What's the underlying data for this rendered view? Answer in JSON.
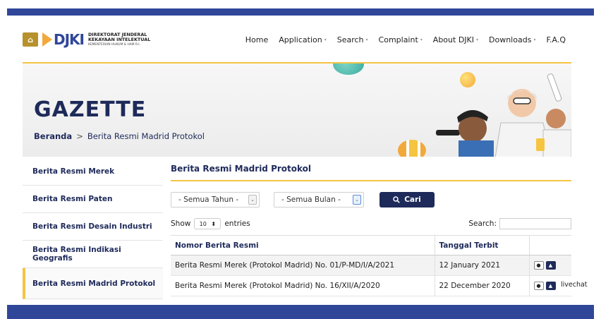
{
  "brand": {
    "line1": "DIREKTORAT JENDERAL",
    "line2": "KEKAYAAN INTELEKTUAL",
    "line3": "KEMENTERIAN HUKUM & HAM R.I.",
    "mark": "DJKI"
  },
  "nav": [
    {
      "label": "Home",
      "has_caret": false
    },
    {
      "label": "Application",
      "has_caret": true
    },
    {
      "label": "Search",
      "has_caret": true
    },
    {
      "label": "Complaint",
      "has_caret": true
    },
    {
      "label": "About DJKI",
      "has_caret": true
    },
    {
      "label": "Downloads",
      "has_caret": true
    },
    {
      "label": "F.A.Q",
      "has_caret": false
    }
  ],
  "hero": {
    "title": "GAZETTE",
    "breadcrumb_home": "Beranda",
    "breadcrumb_sep": ">",
    "breadcrumb_current": "Berita Resmi Madrid Protokol"
  },
  "sidebar": [
    {
      "label": "Berita Resmi Merek",
      "active": false
    },
    {
      "label": "Berita Resmi Paten",
      "active": false
    },
    {
      "label": "Berita Resmi Desain Industri",
      "active": false
    },
    {
      "label": "Berita Resmi Indikasi Geografis",
      "active": false
    },
    {
      "label": "Berita Resmi Madrid Protokol",
      "active": true
    }
  ],
  "content": {
    "title": "Berita Resmi Madrid Protokol",
    "year_select": "- Semua Tahun -",
    "month_select": "- Semua Bulan -",
    "search_button": "Cari",
    "show_label": "Show",
    "entries_value": "10",
    "entries_label": "entries",
    "search_label": "Search:",
    "columns": [
      "Nomor Berita Resmi",
      "Tanggal Terbit",
      ""
    ],
    "rows": [
      {
        "nomor": "Berita Resmi Merek (Protokol Madrid) No. 01/P-MD/I/A/2021",
        "tanggal": "12 January 2021"
      },
      {
        "nomor": "Berita Resmi Merek (Protokol Madrid) No. 16/XII/A/2020",
        "tanggal": "22 December 2020"
      }
    ]
  },
  "livechat": "livechat",
  "colors": {
    "accent": "#f5c542",
    "primary": "#1e2a5a",
    "bar": "#2f4699"
  }
}
